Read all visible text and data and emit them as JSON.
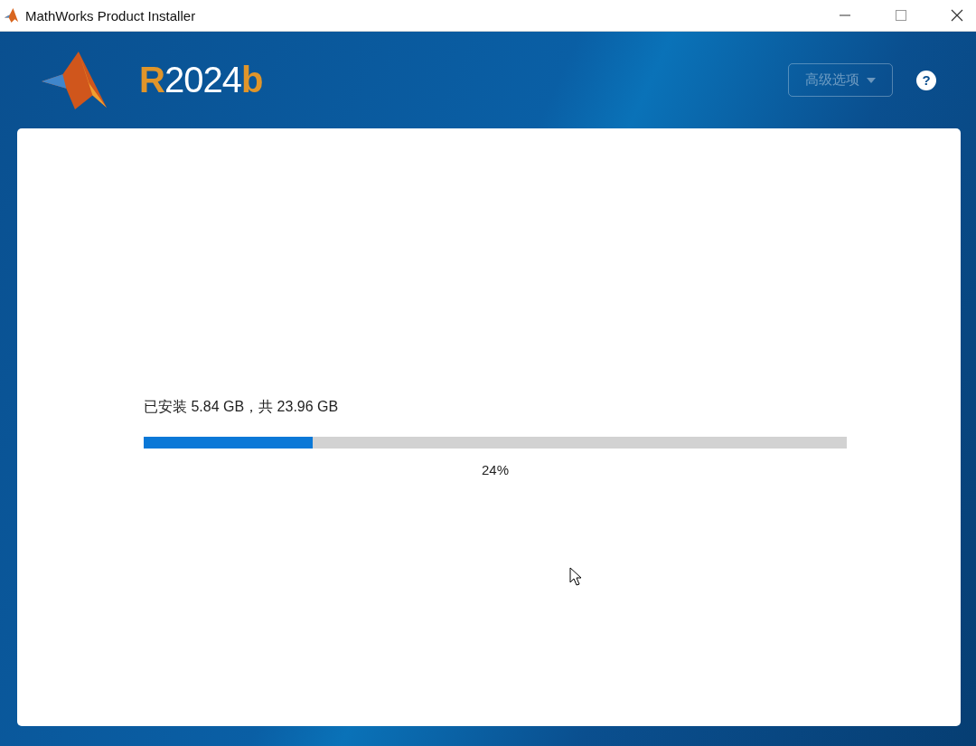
{
  "window": {
    "title": "MathWorks Product Installer"
  },
  "header": {
    "release": "**R**2024**b**",
    "advanced_button": {
      "label": "高级选项",
      "disabled": true
    },
    "help": "?"
  },
  "progress": {
    "label": "已安装 5.84 GB，共 23.96 GB",
    "level": 0.24,
    "percent": "24%"
  }
}
